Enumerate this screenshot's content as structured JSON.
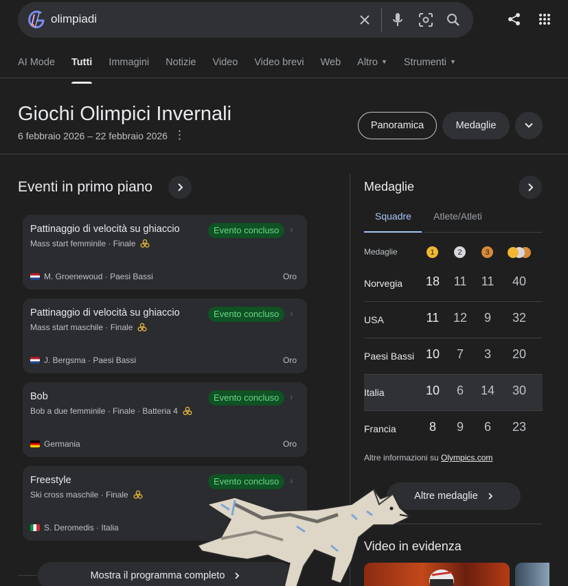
{
  "search": {
    "query": "olimpiadi",
    "icons": [
      "google-logo-icon",
      "clear-icon",
      "mic-icon",
      "lens-icon",
      "search-icon"
    ]
  },
  "top_icons": [
    "share-icon",
    "apps-grid-icon"
  ],
  "tabs": [
    {
      "label": "AI Mode"
    },
    {
      "label": "Tutti",
      "active": true
    },
    {
      "label": "Immagini"
    },
    {
      "label": "Notizie"
    },
    {
      "label": "Video"
    },
    {
      "label": "Video brevi"
    },
    {
      "label": "Web"
    },
    {
      "label": "Altro",
      "dropdown": true
    },
    {
      "label": "Strumenti",
      "dropdown": true
    }
  ],
  "header": {
    "title": "Giochi Olimpici Invernali",
    "dates": "6 febbraio 2026 – 22 febbraio 2026",
    "chips": {
      "overview": "Panoramica",
      "medals": "Medaglie"
    }
  },
  "events": {
    "title": "Eventi in primo piano",
    "cards": [
      {
        "sport": "Pattinaggio di velocità su ghiaccio",
        "sub": "Mass start femminile · Finale",
        "status": "Evento concluso",
        "athlete": "M. Groenewoud",
        "country": "Paesi Bassi",
        "flag": "nl",
        "result": "Oro"
      },
      {
        "sport": "Pattinaggio di velocità su ghiaccio",
        "sub": "Mass start maschile · Finale",
        "status": "Evento concluso",
        "athlete": "J. Bergsma",
        "country": "Paesi Bassi",
        "flag": "nl",
        "result": "Oro"
      },
      {
        "sport": "Bob",
        "sub": "Bob a due femminile · Finale · Batteria 4",
        "status": "Evento concluso",
        "athlete": "",
        "country": "Germania",
        "flag": "de",
        "result": "Oro"
      },
      {
        "sport": "Freestyle",
        "sub": "Ski cross maschile · Finale",
        "status": "Evento concluso",
        "athlete": "S. Deromedis",
        "country": "Italia",
        "flag": "it",
        "result": ""
      }
    ],
    "more_button": "Mostra il programma completo"
  },
  "medals": {
    "title": "Medaglie",
    "tabs": {
      "teams": "Squadre",
      "athletes": "Atlete/Atleti"
    },
    "header_label": "Medaglie",
    "coin_labels": [
      "1",
      "2",
      "3"
    ],
    "coin_colors": {
      "gold": "#f2b632",
      "silver": "#d5d7da",
      "bronze": "#d88a3a"
    },
    "rows": [
      {
        "country": "Norvegia",
        "gold": "18",
        "silver": "11",
        "bronze": "11",
        "total": "40"
      },
      {
        "country": "USA",
        "gold": "11",
        "silver": "12",
        "bronze": "9",
        "total": "32"
      },
      {
        "country": "Paesi Bassi",
        "gold": "10",
        "silver": "7",
        "bronze": "3",
        "total": "20"
      },
      {
        "country": "Italia",
        "gold": "10",
        "silver": "6",
        "bronze": "14",
        "total": "30",
        "highlighted": true
      },
      {
        "country": "Francia",
        "gold": "8",
        "silver": "9",
        "bronze": "6",
        "total": "23"
      }
    ],
    "more_info_prefix": "Altre informazioni su ",
    "more_info_link": "Olympics.com",
    "more_button": "Altre medaglie"
  },
  "videos": {
    "title": "Video in evidenza"
  },
  "colors": {
    "background": "#1f1f1f",
    "badge_bg": "#0f5223",
    "badge_text": "#6dd58c",
    "accent": "#a8c7fa"
  }
}
